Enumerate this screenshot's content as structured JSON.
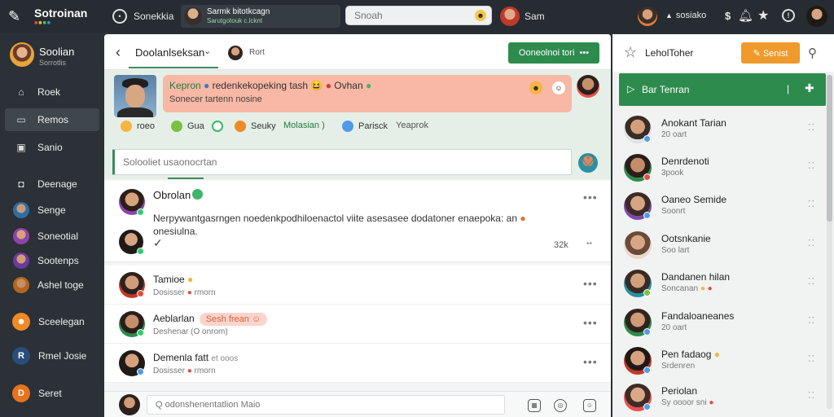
{
  "app": {
    "name": "Sotroinan",
    "dots": [
      "■",
      "■",
      "■",
      "■"
    ]
  },
  "topbar": {
    "nav1": "Sonekkia",
    "chip_title": "Sarmk bitotkcagn",
    "chip_sub": "Sarutgotouk c.lcknt",
    "search_placeholder": "Snoah",
    "user_label": "Sam",
    "status_label": "sosiako",
    "dollar": "$",
    "icons": [
      "bell-icon",
      "star-icon",
      "info-icon"
    ]
  },
  "sidebar": {
    "profile_name": "Soolian",
    "profile_sub": "Sorrotlis",
    "items": [
      {
        "label": "Roek",
        "icon": "home-icon"
      },
      {
        "label": "Remos",
        "icon": "chat-icon"
      },
      {
        "label": "Sanio",
        "icon": "tv-icon"
      },
      {
        "label": "Deenage",
        "icon": "camera-icon"
      },
      {
        "label": "Senge",
        "icon": "avatar"
      },
      {
        "label": "Soneotial",
        "icon": "avatar"
      },
      {
        "label": "Sootenps",
        "icon": "avatar"
      },
      {
        "label": "Ashel toge",
        "icon": "avatar"
      },
      {
        "label": "Sceelegan",
        "icon": "orange-dot"
      },
      {
        "label": "Rmel Josie",
        "icon": "R"
      },
      {
        "label": "Seret",
        "icon": "D"
      }
    ]
  },
  "main": {
    "title": "Doolanlseksan",
    "header_sub": "Rort",
    "action_button": "Ooneolnoi tori",
    "banner_title": "Kepron",
    "banner_text": "redenkekopeking tash",
    "banner_tail": "Ovhan",
    "banner_line2": "Sonecer tartenn nosine",
    "reactions": [
      {
        "label": "roeo",
        "color": "#f5b53f"
      },
      {
        "label": "Gua",
        "color": "#7ac142"
      },
      {
        "label": "",
        "color": "#3fb56a"
      },
      {
        "label": "Seuky",
        "color": "#f08a24"
      },
      {
        "label": "Molasian )",
        "color": "#3fb56a"
      },
      {
        "label": "Parisck",
        "color": "#4f9be8"
      },
      {
        "label": "Yeaprok",
        "color": ""
      }
    ],
    "composer_placeholder": "Solooliet usaonocrtan",
    "post": {
      "name": "Obrolan",
      "body": "Nerpywantgasrngen noedenkpodhiloenactol viite asesasee dodatoner enaepoka: an",
      "body2": "onesiulna.",
      "count": "32k"
    },
    "items": [
      {
        "name": "Tamioe",
        "sub": "Dosisser",
        "sub2": "rmorn"
      },
      {
        "name": "Aeblarlan",
        "pill": "Sesh frean",
        "sub": "Deshenar",
        "sub2": "(O onrom)"
      },
      {
        "name": "Demenla fatt",
        "name2": "et ooos",
        "sub": "Dosisser",
        "sub2": "rmorn"
      }
    ],
    "bottom_placeholder": "Q odonshenentatlion Maio"
  },
  "right": {
    "title": "LeholToher",
    "button": "Senist",
    "green_bar": "Bar Tenran",
    "contacts": [
      {
        "name": "Anokant Tarian",
        "sub": "20 oart",
        "badge": "#4f9be8"
      },
      {
        "name": "Denrdenoti",
        "sub": "3pook",
        "badge": "#e74c3c"
      },
      {
        "name": "Oaneo Semide",
        "sub": "Soonrt",
        "badge": "#4f9be8"
      },
      {
        "name": "Ootsnkanie",
        "sub": "Soo lart",
        "badge": ""
      },
      {
        "name": "Dandanen hilan",
        "sub": "Soncanan",
        "badge": "#7ac142"
      },
      {
        "name": "Fandaloaneanes",
        "sub": "20 oart",
        "badge": "#4f9be8"
      },
      {
        "name": "Pen fadaog",
        "sub": "Srdenren",
        "badge": "#4f9be8"
      },
      {
        "name": "Periolan",
        "sub": "Sy oooor sni",
        "badge": "#4f9be8"
      }
    ]
  },
  "colors": {
    "green": "#2e8b4e",
    "orange": "#ef9a2b",
    "banner": "#f9b7a5",
    "dark": "#262c31"
  }
}
